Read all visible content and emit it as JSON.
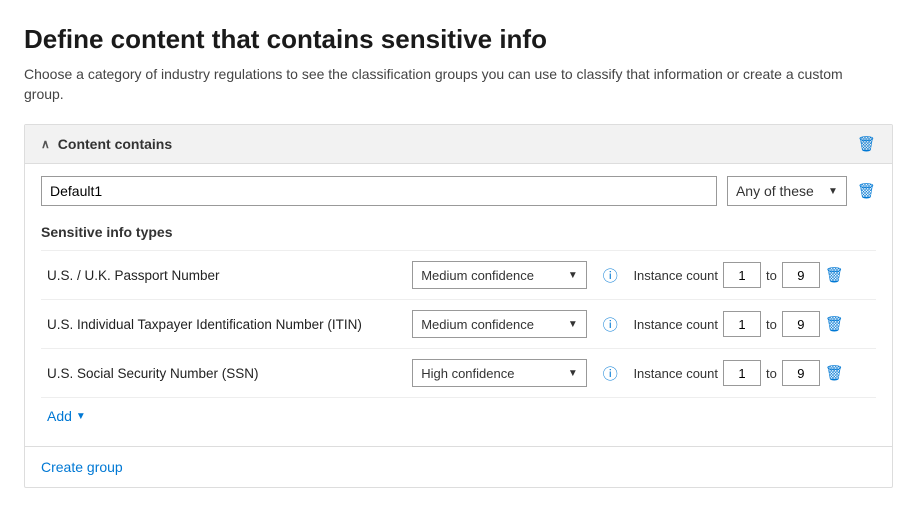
{
  "page": {
    "title": "Define content that contains sensitive info",
    "subtitle": "Choose a category of industry regulations to see the classification groups you can use to classify that information or create a custom group."
  },
  "card": {
    "header_label": "Content contains",
    "group_input_value": "Default1",
    "group_input_placeholder": "Default1",
    "any_of_these_label": "Any of these",
    "section_label": "Sensitive info types",
    "rows": [
      {
        "name": "U.S. / U.K. Passport Number",
        "confidence": "Medium confidence",
        "instance_from": "1",
        "instance_to": "9"
      },
      {
        "name": "U.S. Individual Taxpayer Identification Number (ITIN)",
        "confidence": "Medium confidence",
        "instance_from": "1",
        "instance_to": "9"
      },
      {
        "name": "U.S. Social Security Number (SSN)",
        "confidence": "High confidence",
        "instance_from": "1",
        "instance_to": "9"
      }
    ],
    "instance_count_label": "Instance count",
    "to_label": "to",
    "add_label": "Add",
    "create_group_label": "Create group"
  }
}
